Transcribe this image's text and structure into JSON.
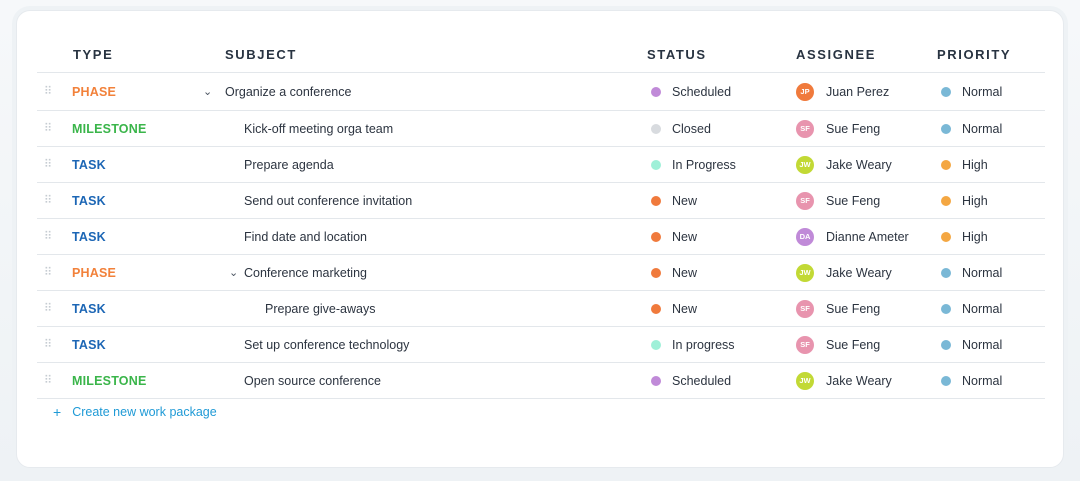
{
  "columns": {
    "type": "TYPE",
    "subject": "SUBJECT",
    "status": "STATUS",
    "assignee": "ASSIGNEE",
    "priority": "PRIORITY"
  },
  "colors": {
    "phase": "#f2813a",
    "milestone": "#3ab54a",
    "task": "#1c66b5",
    "status_scheduled": "#c08ad8",
    "status_closed": "#d8dbdf",
    "status_inprogress": "#9ff0d8",
    "status_new": "#f07a3c",
    "priority_normal": "#7ab8d6",
    "priority_high": "#f4a742",
    "avatar_jp": "#f07a3c",
    "avatar_sf": "#e894ae",
    "avatar_jw": "#c2d935",
    "avatar_da": "#c08ad8",
    "link": "#1f9ad6"
  },
  "rows": [
    {
      "type": "PHASE",
      "type_kind": "phase",
      "subject": "Organize a conference",
      "indent": 0,
      "expandable": true,
      "status": "Scheduled",
      "status_kind": "status_scheduled",
      "initials": "JP",
      "avatar_kind": "avatar_jp",
      "assignee": "Juan Perez",
      "priority": "Normal",
      "priority_kind": "priority_normal"
    },
    {
      "type": "MILESTONE",
      "type_kind": "milestone",
      "subject": "Kick-off meeting orga team",
      "indent": 1,
      "expandable": false,
      "status": "Closed",
      "status_kind": "status_closed",
      "initials": "SF",
      "avatar_kind": "avatar_sf",
      "assignee": "Sue Feng",
      "priority": "Normal",
      "priority_kind": "priority_normal"
    },
    {
      "type": "TASK",
      "type_kind": "task",
      "subject": "Prepare agenda",
      "indent": 1,
      "expandable": false,
      "status": "In Progress",
      "status_kind": "status_inprogress",
      "initials": "JW",
      "avatar_kind": "avatar_jw",
      "assignee": "Jake Weary",
      "priority": "High",
      "priority_kind": "priority_high"
    },
    {
      "type": "TASK",
      "type_kind": "task",
      "subject": "Send out conference invitation",
      "indent": 1,
      "expandable": false,
      "status": "New",
      "status_kind": "status_new",
      "initials": "SF",
      "avatar_kind": "avatar_sf",
      "assignee": "Sue Feng",
      "priority": "High",
      "priority_kind": "priority_high"
    },
    {
      "type": "TASK",
      "type_kind": "task",
      "subject": "Find date and location",
      "indent": 1,
      "expandable": false,
      "status": "New",
      "status_kind": "status_new",
      "initials": "DA",
      "avatar_kind": "avatar_da",
      "assignee": "Dianne Ameter",
      "priority": "High",
      "priority_kind": "priority_high"
    },
    {
      "type": "PHASE",
      "type_kind": "phase",
      "subject": "Conference marketing",
      "indent": 1,
      "expandable": true,
      "status": "New",
      "status_kind": "status_new",
      "initials": "JW",
      "avatar_kind": "avatar_jw",
      "assignee": "Jake Weary",
      "priority": "Normal",
      "priority_kind": "priority_normal"
    },
    {
      "type": "TASK",
      "type_kind": "task",
      "subject": "Prepare give-aways",
      "indent": 2,
      "expandable": false,
      "status": "New",
      "status_kind": "status_new",
      "initials": "SF",
      "avatar_kind": "avatar_sf",
      "assignee": "Sue Feng",
      "priority": "Normal",
      "priority_kind": "priority_normal"
    },
    {
      "type": "TASK",
      "type_kind": "task",
      "subject": "Set up conference technology",
      "indent": 1,
      "expandable": false,
      "status": "In progress",
      "status_kind": "status_inprogress",
      "initials": "SF",
      "avatar_kind": "avatar_sf",
      "assignee": "Sue Feng",
      "priority": "Normal",
      "priority_kind": "priority_normal"
    },
    {
      "type": "MILESTONE",
      "type_kind": "milestone",
      "subject": "Open source conference",
      "indent": 1,
      "expandable": false,
      "status": "Scheduled",
      "status_kind": "status_scheduled",
      "initials": "JW",
      "avatar_kind": "avatar_jw",
      "assignee": "Jake Weary",
      "priority": "Normal",
      "priority_kind": "priority_normal"
    }
  ],
  "create": {
    "icon": "plus-icon",
    "label": "Create new work package"
  }
}
